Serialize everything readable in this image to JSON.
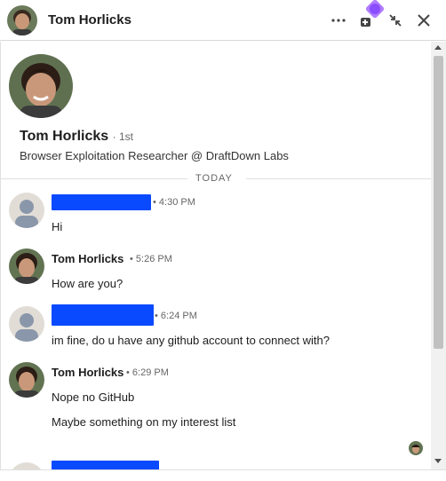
{
  "header": {
    "name": "Tom Horlicks"
  },
  "profile": {
    "name": "Tom Horlicks",
    "degree": "· 1st",
    "headline": "Browser Exploitation Researcher @ DraftDown Labs"
  },
  "divider": "TODAY",
  "messages": [
    {
      "sender": "",
      "time": "• 4:30 PM",
      "lines": [
        "Hi"
      ]
    },
    {
      "sender": "Tom Horlicks",
      "time": "• 5:26 PM",
      "lines": [
        "How are you?"
      ]
    },
    {
      "sender": "",
      "time": "• 6:24 PM",
      "lines": [
        "im fine, do u have any github account to connect with?"
      ]
    },
    {
      "sender": "Tom Horlicks",
      "time": "• 6:29 PM",
      "lines": [
        "Nope no GitHub",
        "Maybe something on my interest list"
      ]
    }
  ],
  "icons": {
    "more": "ellipsis-icon",
    "compose": "new-message-icon",
    "minimize": "collapse-arrows-icon",
    "close": "close-icon"
  },
  "colors": {
    "redaction": "#0a4aff",
    "extension_badge": "#9b59ff"
  }
}
